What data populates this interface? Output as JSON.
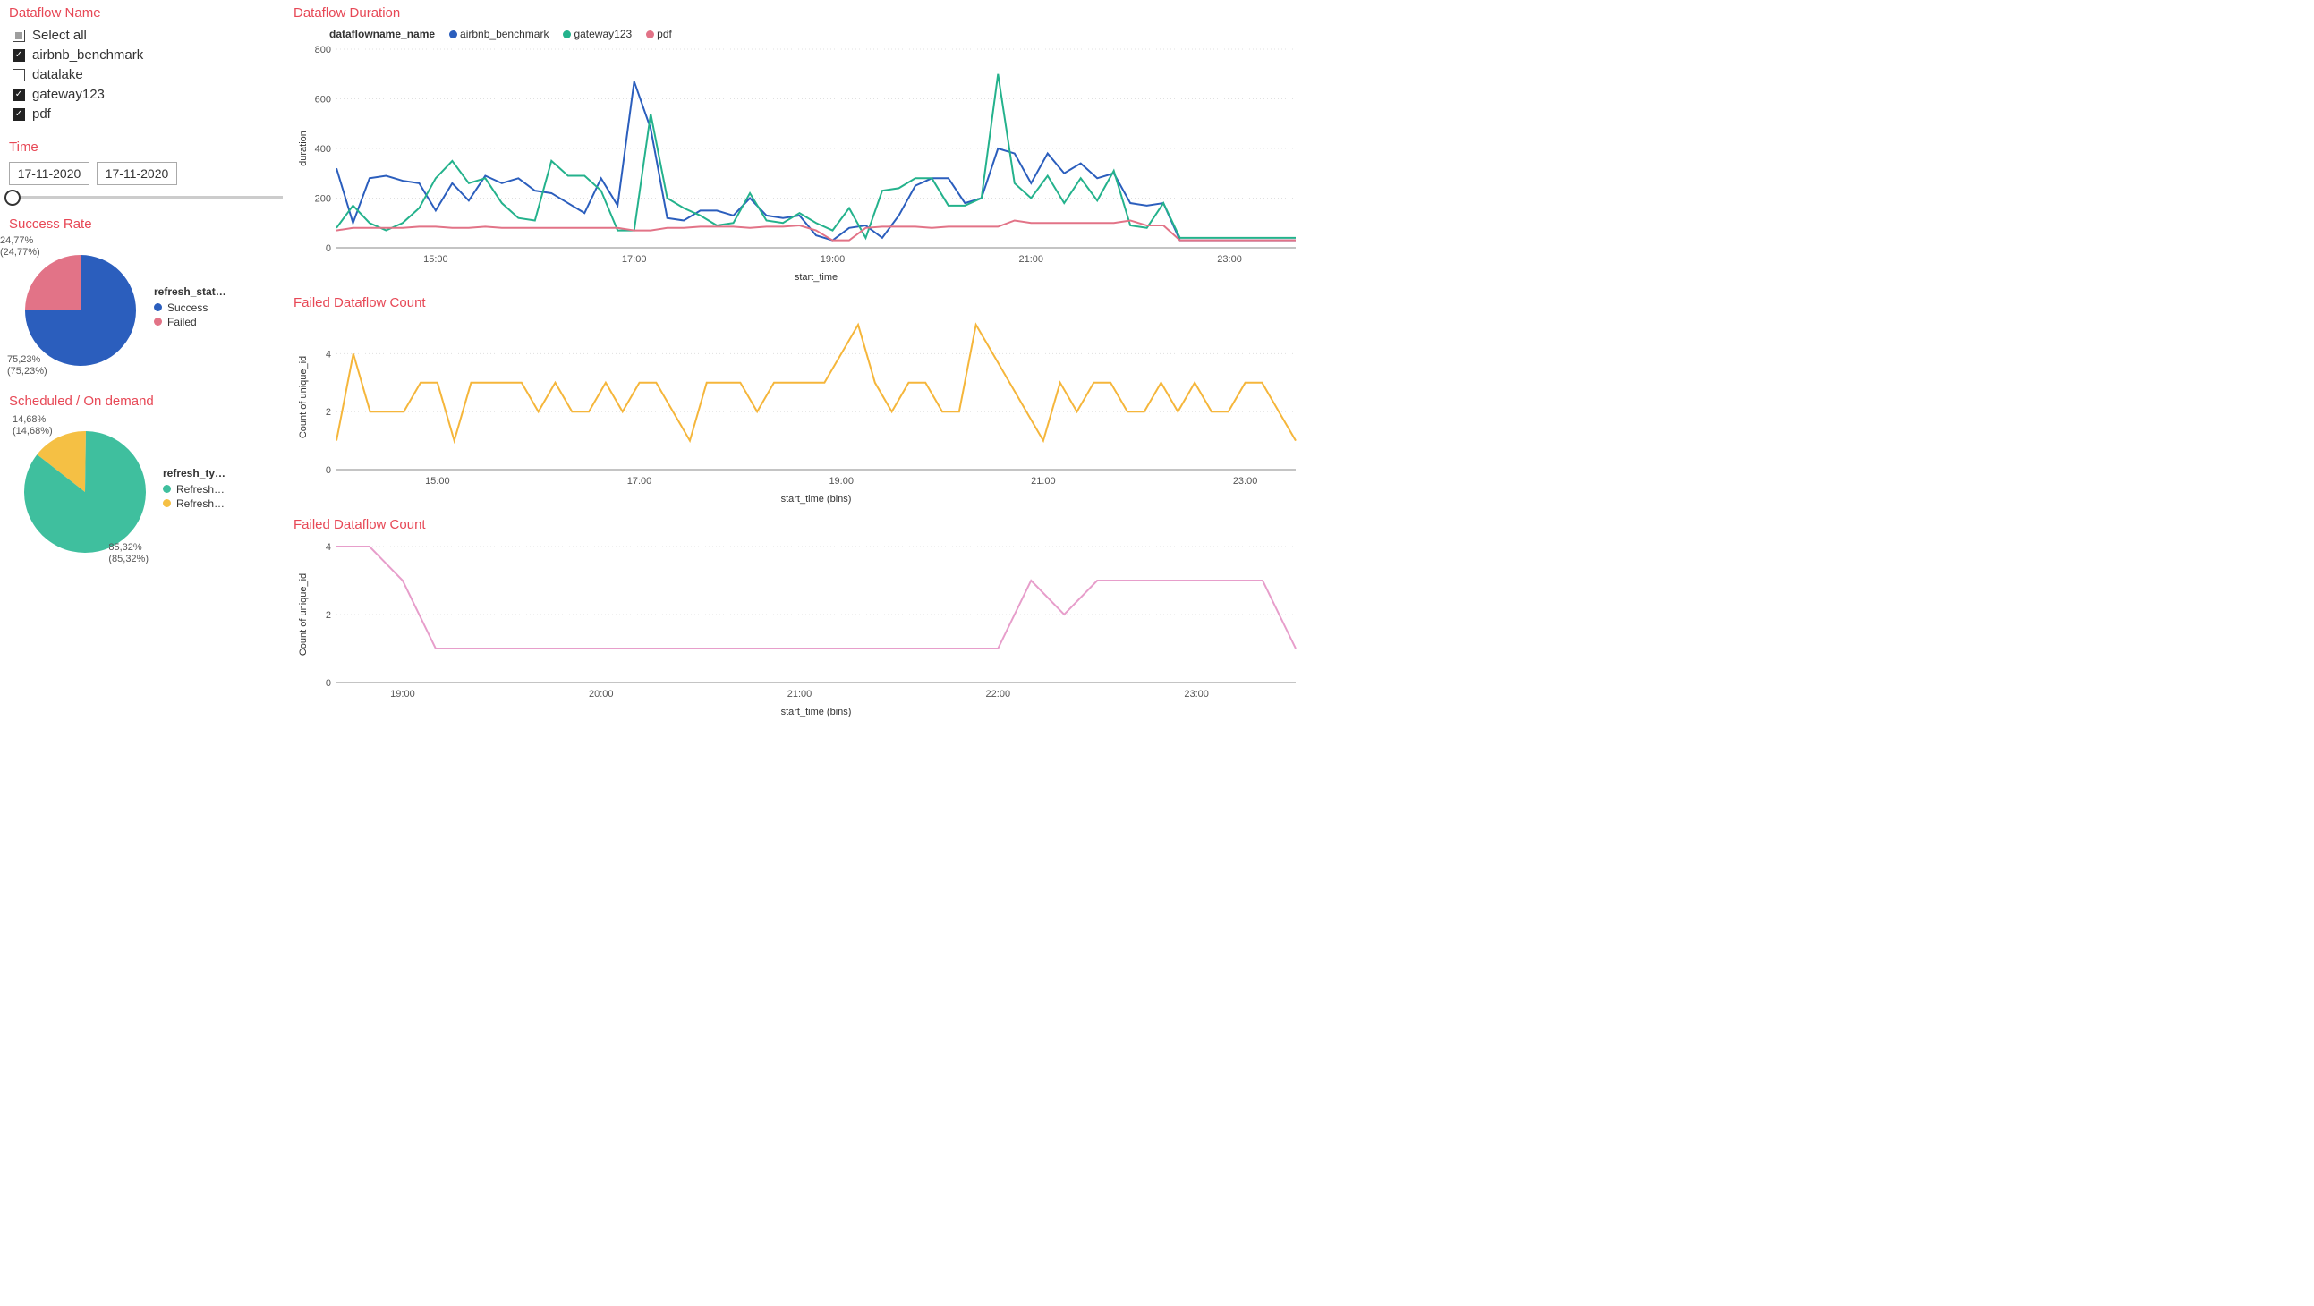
{
  "filters": {
    "dataflow_name_title": "Dataflow Name",
    "items": [
      {
        "label": "Select all",
        "state": "partial"
      },
      {
        "label": "airbnb_benchmark",
        "state": "checked"
      },
      {
        "label": "datalake",
        "state": "unchecked"
      },
      {
        "label": "gateway123",
        "state": "checked"
      },
      {
        "label": "pdf",
        "state": "checked"
      }
    ],
    "time_title": "Time",
    "date_from": "17-11-2020",
    "date_to": "17-11-2020"
  },
  "success_rate": {
    "title": "Success Rate",
    "legend_title": "refresh_stat…",
    "legend_items": [
      {
        "label": "Success",
        "color": "#2b5ebd"
      },
      {
        "label": "Failed",
        "color": "#e27387"
      }
    ],
    "pie_labels": [
      {
        "text1": "24,77%",
        "text2": "(24,77%)"
      },
      {
        "text1": "75,23%",
        "text2": "(75,23%)"
      }
    ]
  },
  "scheduled": {
    "title": "Scheduled / On demand",
    "legend_title": "refresh_ty…",
    "legend_items": [
      {
        "label": "Refresh…",
        "color": "#3fbf9e"
      },
      {
        "label": "Refresh…",
        "color": "#f5c044"
      }
    ],
    "pie_labels": [
      {
        "text1": "14,68%",
        "text2": "(14,68%)"
      },
      {
        "text1": "85,32%",
        "text2": "(85,32%)"
      }
    ]
  },
  "duration_chart": {
    "title": "Dataflow Duration",
    "legend_title": "dataflowname_name",
    "xlabel": "start_time",
    "ylabel": "duration"
  },
  "failed_chart1": {
    "title": "Failed Dataflow Count",
    "xlabel": "start_time (bins)",
    "ylabel": "Count of unique_id"
  },
  "failed_chart2": {
    "title": "Failed Dataflow Count",
    "xlabel": "start_time (bins)",
    "ylabel": "Count of unique_id"
  },
  "chart_data": [
    {
      "type": "line",
      "title": "Dataflow Duration",
      "xlabel": "start_time",
      "ylabel": "duration",
      "ylim": [
        0,
        800
      ],
      "x_ticks": [
        "15:00",
        "17:00",
        "19:00",
        "21:00",
        "23:00"
      ],
      "x": [
        "14:00",
        "14:10",
        "14:20",
        "14:30",
        "14:40",
        "14:50",
        "15:00",
        "15:10",
        "15:20",
        "15:30",
        "15:40",
        "15:50",
        "16:00",
        "16:10",
        "16:20",
        "16:30",
        "16:40",
        "16:50",
        "17:00",
        "17:10",
        "17:20",
        "17:30",
        "17:40",
        "17:50",
        "18:00",
        "18:10",
        "18:20",
        "18:30",
        "18:40",
        "18:50",
        "19:00",
        "19:10",
        "19:20",
        "19:30",
        "19:40",
        "19:50",
        "20:00",
        "20:10",
        "20:20",
        "20:30",
        "20:40",
        "20:50",
        "21:00",
        "21:10",
        "21:20",
        "21:30",
        "21:40",
        "21:50",
        "22:00",
        "22:10",
        "22:20",
        "22:30",
        "22:40",
        "22:50",
        "23:00",
        "23:10",
        "23:20",
        "23:30",
        "23:40"
      ],
      "series": [
        {
          "name": "airbnb_benchmark",
          "color": "#2b5ebd",
          "values": [
            320,
            100,
            280,
            290,
            270,
            260,
            150,
            260,
            190,
            290,
            260,
            280,
            230,
            220,
            180,
            140,
            280,
            170,
            670,
            480,
            120,
            110,
            150,
            150,
            130,
            200,
            130,
            120,
            130,
            50,
            30,
            80,
            90,
            40,
            130,
            250,
            280,
            280,
            180,
            200,
            400,
            380,
            260,
            380,
            300,
            340,
            280,
            300,
            180,
            170,
            180,
            30,
            30,
            30,
            30,
            30,
            30,
            30,
            30
          ]
        },
        {
          "name": "gateway123",
          "color": "#24b28c",
          "values": [
            80,
            170,
            100,
            70,
            100,
            160,
            280,
            350,
            260,
            280,
            180,
            120,
            110,
            350,
            290,
            290,
            230,
            70,
            70,
            540,
            200,
            160,
            130,
            90,
            100,
            220,
            110,
            100,
            140,
            100,
            70,
            160,
            40,
            230,
            240,
            280,
            280,
            170,
            170,
            200,
            700,
            260,
            200,
            290,
            180,
            280,
            190,
            310,
            90,
            80,
            180,
            40,
            40,
            40,
            40,
            40,
            40,
            40,
            40
          ]
        },
        {
          "name": "pdf",
          "color": "#e27387",
          "values": [
            70,
            80,
            80,
            80,
            80,
            85,
            85,
            80,
            80,
            85,
            80,
            80,
            80,
            80,
            80,
            80,
            80,
            80,
            70,
            70,
            80,
            80,
            85,
            85,
            85,
            80,
            85,
            85,
            90,
            70,
            30,
            30,
            80,
            85,
            85,
            85,
            80,
            85,
            85,
            85,
            85,
            110,
            100,
            100,
            100,
            100,
            100,
            100,
            110,
            90,
            90,
            30,
            30,
            30,
            30,
            30,
            30,
            30,
            30
          ]
        }
      ]
    },
    {
      "type": "line",
      "title": "Failed Dataflow Count",
      "xlabel": "start_time (bins)",
      "ylabel": "Count of unique_id",
      "ylim": [
        0,
        5
      ],
      "y_ticks": [
        0,
        2,
        4
      ],
      "x_ticks": [
        "15:00",
        "17:00",
        "19:00",
        "21:00",
        "23:00"
      ],
      "x": [
        "14:00",
        "14:10",
        "14:20",
        "14:30",
        "14:40",
        "14:50",
        "15:00",
        "15:10",
        "15:20",
        "15:30",
        "15:40",
        "15:50",
        "16:00",
        "16:10",
        "16:20",
        "16:30",
        "16:40",
        "16:50",
        "17:00",
        "17:10",
        "17:20",
        "17:30",
        "17:40",
        "17:50",
        "18:00",
        "18:10",
        "18:20",
        "18:30",
        "18:40",
        "18:50",
        "19:00",
        "19:10",
        "19:20",
        "19:30",
        "19:40",
        "19:50",
        "20:00",
        "20:10",
        "20:20",
        "20:30",
        "20:40",
        "20:50",
        "21:00",
        "21:10",
        "21:20",
        "21:30",
        "21:40",
        "21:50",
        "22:00",
        "22:10",
        "22:20",
        "22:30",
        "22:40",
        "22:50",
        "23:00",
        "23:10",
        "23:20",
        "23:30"
      ],
      "series": [
        {
          "name": "failed",
          "color": "#f5b63b",
          "values": [
            1,
            4,
            2,
            2,
            2,
            3,
            3,
            1,
            3,
            3,
            3,
            3,
            2,
            3,
            2,
            2,
            3,
            2,
            3,
            3,
            2,
            1,
            3,
            3,
            3,
            2,
            3,
            3,
            3,
            3,
            4,
            5,
            3,
            2,
            3,
            3,
            2,
            2,
            5,
            4,
            3,
            2,
            1,
            3,
            2,
            3,
            3,
            2,
            2,
            3,
            2,
            3,
            2,
            2,
            3,
            3,
            2,
            1
          ]
        }
      ]
    },
    {
      "type": "line",
      "title": "Failed Dataflow Count",
      "xlabel": "start_time (bins)",
      "ylabel": "Count of unique_id",
      "ylim": [
        0,
        4
      ],
      "y_ticks": [
        0,
        2,
        4
      ],
      "x_ticks": [
        "19:00",
        "20:00",
        "21:00",
        "22:00",
        "23:00"
      ],
      "x": [
        "18:40",
        "18:50",
        "19:00",
        "19:10",
        "19:20",
        "19:30",
        "19:40",
        "19:50",
        "20:00",
        "20:10",
        "20:20",
        "20:30",
        "20:40",
        "20:50",
        "21:00",
        "21:10",
        "21:20",
        "21:30",
        "21:40",
        "21:50",
        "22:00",
        "22:10",
        "22:20",
        "22:30",
        "22:40",
        "22:50",
        "23:00",
        "23:10",
        "23:20",
        "23:30"
      ],
      "series": [
        {
          "name": "failed",
          "color": "#e79ecb",
          "values": [
            4,
            4,
            3,
            1,
            1,
            1,
            1,
            1,
            1,
            1,
            1,
            1,
            1,
            1,
            1,
            1,
            1,
            1,
            1,
            1,
            1,
            3,
            2,
            3,
            3,
            3,
            3,
            3,
            3,
            1
          ]
        }
      ]
    },
    {
      "type": "pie",
      "title": "Success Rate",
      "legend_title": "refresh_status",
      "series": [
        {
          "name": "Success",
          "value": 75.23,
          "color": "#2b5ebd"
        },
        {
          "name": "Failed",
          "value": 24.77,
          "color": "#e27387"
        }
      ]
    },
    {
      "type": "pie",
      "title": "Scheduled / On demand",
      "legend_title": "refresh_type",
      "series": [
        {
          "name": "Refresh…",
          "value": 85.32,
          "color": "#3fbf9e"
        },
        {
          "name": "Refresh…",
          "value": 14.68,
          "color": "#f5c044"
        }
      ]
    }
  ]
}
